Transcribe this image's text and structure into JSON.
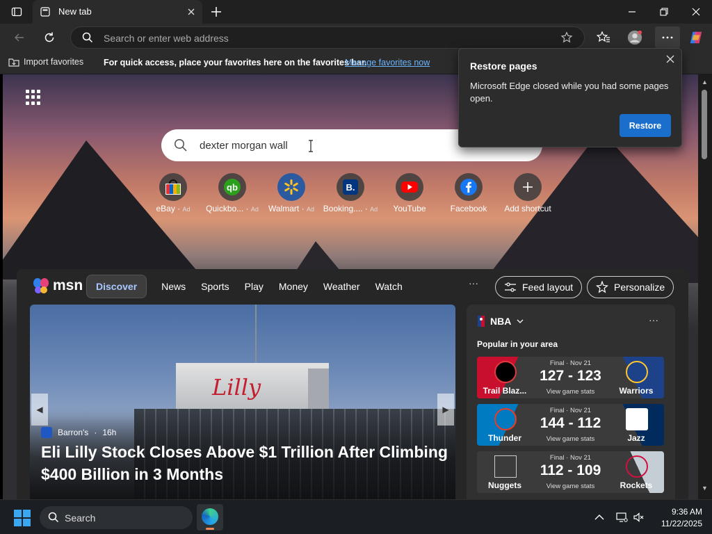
{
  "browser": {
    "tab": {
      "title": "New tab"
    },
    "address_bar": {
      "placeholder": "Search or enter web address"
    },
    "favorites_bar": {
      "import_label": "Import favorites",
      "hint": "For quick access, place your favorites here on the favorites bar.",
      "manage_link": "Manage favorites now"
    }
  },
  "newtab": {
    "search": {
      "query": "dexter morgan wall"
    },
    "shortcuts": [
      {
        "label": "eBay",
        "ad": "Ad",
        "icon": "ebay-icon"
      },
      {
        "label": "Quickbo...",
        "ad": "Ad",
        "icon": "quickbooks-icon"
      },
      {
        "label": "Walmart",
        "ad": "Ad",
        "icon": "walmart-icon"
      },
      {
        "label": "Booking....",
        "ad": "Ad",
        "icon": "booking-icon"
      },
      {
        "label": "YouTube",
        "ad": "",
        "icon": "youtube-icon"
      },
      {
        "label": "Facebook",
        "ad": "",
        "icon": "facebook-icon"
      },
      {
        "label": "Add shortcut",
        "ad": "",
        "icon": "plus-icon"
      }
    ]
  },
  "msn": {
    "logo_text": "msn",
    "nav": [
      "Discover",
      "News",
      "Sports",
      "Play",
      "Money",
      "Weather",
      "Watch"
    ],
    "more": "···",
    "feed_layout": "Feed layout",
    "personalize": "Personalize",
    "hero": {
      "source": "Barron's",
      "age": "16h",
      "headline": "Eli Lilly Stock Closes Above $1 Trillion After Climbing $400 Billion in 3 Months",
      "sign_text": "Lilly"
    },
    "nba": {
      "title": "NBA",
      "more": "···",
      "popular": "Popular in your area",
      "games": [
        {
          "status": "Final · Nov 21",
          "score": "127 - 123",
          "view": "View game stats",
          "home": "Trail Blaz...",
          "away": "Warriors",
          "home_color": "#c8102e",
          "away_color": "#1d428a"
        },
        {
          "status": "Final · Nov 21",
          "score": "144 - 112",
          "view": "View game stats",
          "home": "Thunder",
          "away": "Jazz",
          "home_color": "#007ac1",
          "away_color": "#002b5c"
        },
        {
          "status": "Final · Nov 21",
          "score": "112 - 109",
          "view": "View game stats",
          "home": "Nuggets",
          "away": "Rockets",
          "home_color": "#0e2240",
          "away_color": "#ce1141"
        }
      ]
    }
  },
  "restore_popup": {
    "title": "Restore pages",
    "body": "Microsoft Edge closed while you had some pages open.",
    "button": "Restore"
  },
  "taskbar": {
    "search_label": "Search",
    "time": "9:36 AM",
    "date": "11/22/2025"
  }
}
